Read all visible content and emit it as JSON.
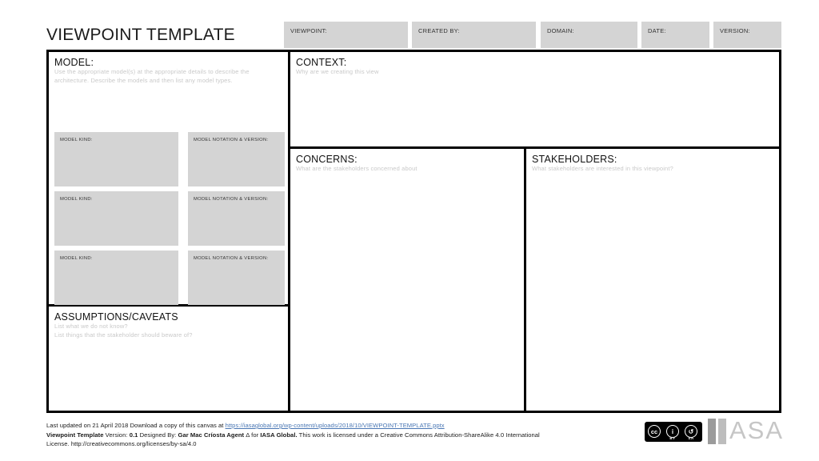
{
  "page_title": "VIEWPOINT TEMPLATE",
  "header_fields": [
    {
      "label": "VIEWPOINT:"
    },
    {
      "label": "CREATED BY:"
    },
    {
      "label": "DOMAIN:"
    },
    {
      "label": "DATE:"
    },
    {
      "label": "VERSION:"
    }
  ],
  "sections": {
    "model": {
      "title": "MODEL:",
      "subtitle": "Use the appropriate model(s) at the appropriate details to describe the architecture. Describe the models and then list any model types.",
      "rows": [
        {
          "kind_label": "MODEL KIND:",
          "notation_label": "MODEL NOTATION & VERSION:"
        },
        {
          "kind_label": "MODEL KIND:",
          "notation_label": "MODEL NOTATION & VERSION:"
        },
        {
          "kind_label": "MODEL KIND:",
          "notation_label": "MODEL NOTATION & VERSION:"
        }
      ]
    },
    "assumptions": {
      "title": "ASSUMPTIONS/CAVEATS",
      "subtitle_line1": "List what we do not know?",
      "subtitle_line2": "List things that the stakeholder should beware of?"
    },
    "context": {
      "title": "CONTEXT:",
      "subtitle": "Why are we creating this view"
    },
    "concerns": {
      "title": "CONCERNS:",
      "subtitle": "What are the stakeholders concerned about"
    },
    "stakeholders": {
      "title": "STAKEHOLDERS:",
      "subtitle": "What stakeholders are interested in this viewpoint?"
    }
  },
  "footer": {
    "line1_prefix": "Last updated on 21 April 2018 Download a copy of this canvas at ",
    "line1_link": "https://iasaglobal.org/wp-content/uploads/2018/10/VIEWPOINT-TEMPLATE.pptx",
    "line2_bold1": "Viewpoint Template",
    "line2_text1": " Version: ",
    "line2_bold2": "0.1",
    "line2_text2": " Designed By: ",
    "line2_bold3": "Gar Mac Críosta Agent",
    "line2_text3": " Δ for ",
    "line2_bold4": "IASA Global.",
    "line2_text4": " This work is licensed under a Creative Commons Attribution-ShareAlike 4.0 International",
    "line3": "License. http://creativecommons.org/licenses/by-sa/4.0"
  },
  "badges": {
    "cc": {
      "mark": "cc",
      "person": "i",
      "share": "↺",
      "by_label": "BY",
      "sa_label": "SA"
    },
    "iasa": {
      "letters": "ASA"
    }
  },
  "colors": {
    "field_fill": "#d4d4d4",
    "border": "#000000",
    "placeholder_text": "#c9c9c9",
    "link": "#4a77b4",
    "logo_gray": "#c6c6c6"
  }
}
